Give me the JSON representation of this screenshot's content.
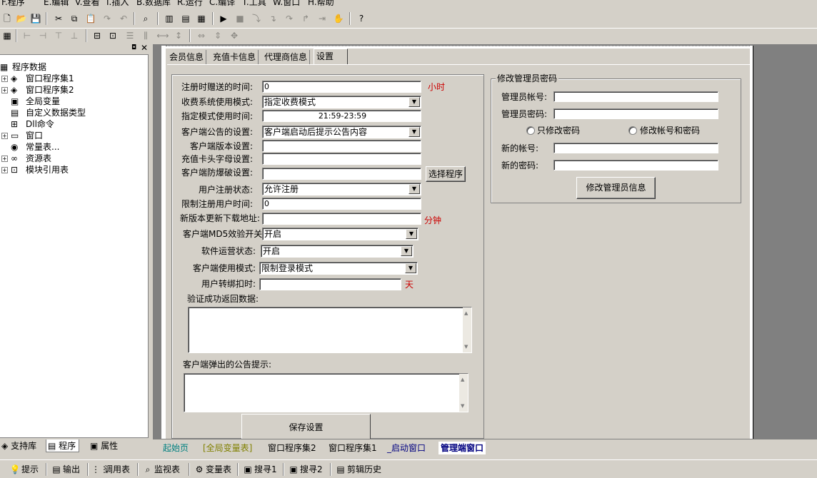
{
  "menu": [
    "F.程序",
    "E.编辑",
    "V.查看",
    "I.插入",
    "B.数据库",
    "R.运行",
    "C.编译",
    "T.工具",
    "W.窗口",
    "H.帮助"
  ],
  "left_panel": {
    "tree": [
      {
        "label": "程序数据",
        "icon": "program-data-icon",
        "glyph": "▦",
        "expand": ""
      },
      {
        "label": "窗口程序集1",
        "icon": "assembly-icon",
        "glyph": "◈",
        "expand": "+"
      },
      {
        "label": "窗口程序集2",
        "icon": "assembly-icon",
        "glyph": "◈",
        "expand": "+"
      },
      {
        "label": "全局变量",
        "icon": "global-var-icon",
        "glyph": "▣",
        "expand": ""
      },
      {
        "label": "自定义数据类型",
        "icon": "custom-type-icon",
        "glyph": "▤",
        "expand": ""
      },
      {
        "label": "Dll命令",
        "icon": "dll-icon",
        "glyph": "⊞",
        "expand": ""
      },
      {
        "label": "窗口",
        "icon": "window-icon",
        "glyph": "▭",
        "expand": "+"
      },
      {
        "label": "常量表...",
        "icon": "constant-icon",
        "glyph": "◉",
        "expand": ""
      },
      {
        "label": "资源表",
        "icon": "resource-icon",
        "glyph": "∞",
        "expand": "+"
      },
      {
        "label": "模块引用表",
        "icon": "module-icon",
        "glyph": "⊡",
        "expand": "+"
      }
    ],
    "tabs": [
      "支持库",
      "程序",
      "属性"
    ]
  },
  "form_tabs": [
    "会员信息",
    "充值卡信息",
    "代理商信息",
    "设置"
  ],
  "settings": {
    "reg_gift_time": {
      "label": "注册时赠送的时间:",
      "value": "0",
      "unit": "小时"
    },
    "charge_mode": {
      "label": "收费系统使用模式:",
      "value": "指定收费模式"
    },
    "mode_time": {
      "label": "指定模式使用时间:",
      "value": "21:59-23:59"
    },
    "notice_setting": {
      "label": "客户端公告的设置:",
      "value": "客户端启动后提示公告内容"
    },
    "version": {
      "label": "客户端版本设置:",
      "value": ""
    },
    "card_prefix": {
      "label": "充值卡头字母设置:",
      "value": ""
    },
    "anti_crack": {
      "label": "客户端防爆破设置:",
      "value": "",
      "button": "选择程序"
    },
    "reg_status": {
      "label": "用户注册状态:",
      "value": "允许注册"
    },
    "reg_limit": {
      "label": "限制注册用户时间:",
      "value": "0"
    },
    "update_url": {
      "label": "新版本更新下载地址:",
      "value": "",
      "unit": "分钟"
    },
    "md5_switch": {
      "label": "客户端MD5效验开关:",
      "value": "开启"
    },
    "run_status": {
      "label": "软件运营状态:",
      "value": "开启"
    },
    "client_mode": {
      "label": "客户端使用模式:",
      "value": "限制登录模式"
    },
    "transfer_deduct": {
      "label": "用户转绑扣时:",
      "value": "",
      "unit": "天"
    },
    "verify_return": {
      "label": "验证成功返回数据:"
    },
    "popup_notice": {
      "label": "客户端弹出的公告提示:"
    },
    "save_button": "保存设置"
  },
  "admin": {
    "group_title": "修改管理员密码",
    "account_label": "管理员帐号:",
    "password_label": "管理员密码:",
    "radio_pwd_only": "只修改密码",
    "radio_both": "修改帐号和密码",
    "new_account_label": "新的帐号:",
    "new_password_label": "新的密码:",
    "button": "修改管理员信息"
  },
  "doc_tabs": [
    "起始页",
    "[全局变量表]",
    "窗口程序集2",
    "窗口程序集1",
    "_启动窗口",
    "管理端窗口"
  ],
  "output_tabs": [
    {
      "label": "提示",
      "icon": "hint-icon",
      "glyph": "💡"
    },
    {
      "label": "输出",
      "icon": "output-icon",
      "glyph": "▤"
    },
    {
      "label": "调用表",
      "icon": "call-table-icon",
      "glyph": "⋮⋮"
    },
    {
      "label": "监视表",
      "icon": "watch-icon",
      "glyph": "⌕"
    },
    {
      "label": "变量表",
      "icon": "variable-icon",
      "glyph": "⚙"
    },
    {
      "label": "搜寻1",
      "icon": "search1-icon",
      "glyph": "▣"
    },
    {
      "label": "搜寻2",
      "icon": "search2-icon",
      "glyph": "▣"
    },
    {
      "label": "剪辑历史",
      "icon": "clip-history-icon",
      "glyph": "▤"
    }
  ],
  "colors": {
    "unit_red": "#cc0000",
    "active_tab_blue": "#000080",
    "start_page_teal": "#008080"
  }
}
